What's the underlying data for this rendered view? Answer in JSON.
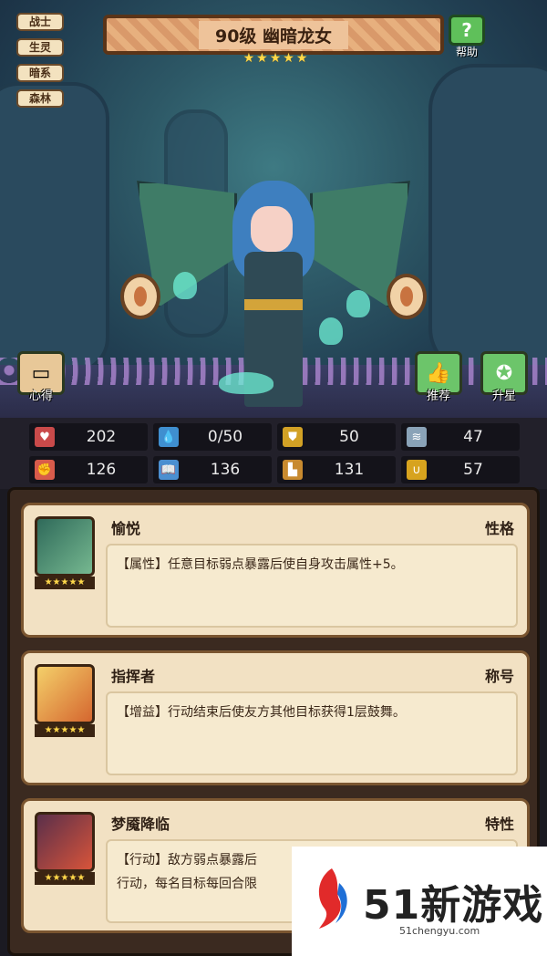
{
  "tags": [
    "战士",
    "生灵",
    "暗系",
    "森林"
  ],
  "title": "90级 幽暗龙女",
  "star_count": 5,
  "help_label": "帮助",
  "left_button_label": "心得",
  "recommend_label": "推荐",
  "upgrade_label": "升星",
  "stats": [
    {
      "icon": "heart-icon",
      "value": "202",
      "color": "#c94a4a",
      "glyph": "♥"
    },
    {
      "icon": "water-drop-icon",
      "value": "0/50",
      "color": "#3f8fd0",
      "glyph": "💧"
    },
    {
      "icon": "shield-icon",
      "value": "50",
      "color": "#d2a125",
      "glyph": "⛊"
    },
    {
      "icon": "wing-icon",
      "value": "47",
      "color": "#8aa3b8",
      "glyph": "≋"
    },
    {
      "icon": "fist-icon",
      "value": "126",
      "color": "#d85b4b",
      "glyph": "✊"
    },
    {
      "icon": "book-icon",
      "value": "136",
      "color": "#4b8fd0",
      "glyph": "📖"
    },
    {
      "icon": "boot-icon",
      "value": "131",
      "color": "#c88a2f",
      "glyph": "▙"
    },
    {
      "icon": "horseshoe-icon",
      "value": "57",
      "color": "#d7a31e",
      "glyph": "∪"
    }
  ],
  "traits": [
    {
      "name": "愉悦",
      "type": "性格",
      "desc": "【属性】任意目标弱点暴露后使自身攻击属性+5。"
    },
    {
      "name": "指挥者",
      "type": "称号",
      "desc": "【增益】行动结束后使友方其他目标获得1层鼓舞。"
    },
    {
      "name": "梦魇降临",
      "type": "特性",
      "desc": "【行动】敌方弱点暴露后\n行动，每名目标每回合限"
    }
  ],
  "watermark": {
    "brand": "51新游戏",
    "url": "51chengyu.com"
  }
}
